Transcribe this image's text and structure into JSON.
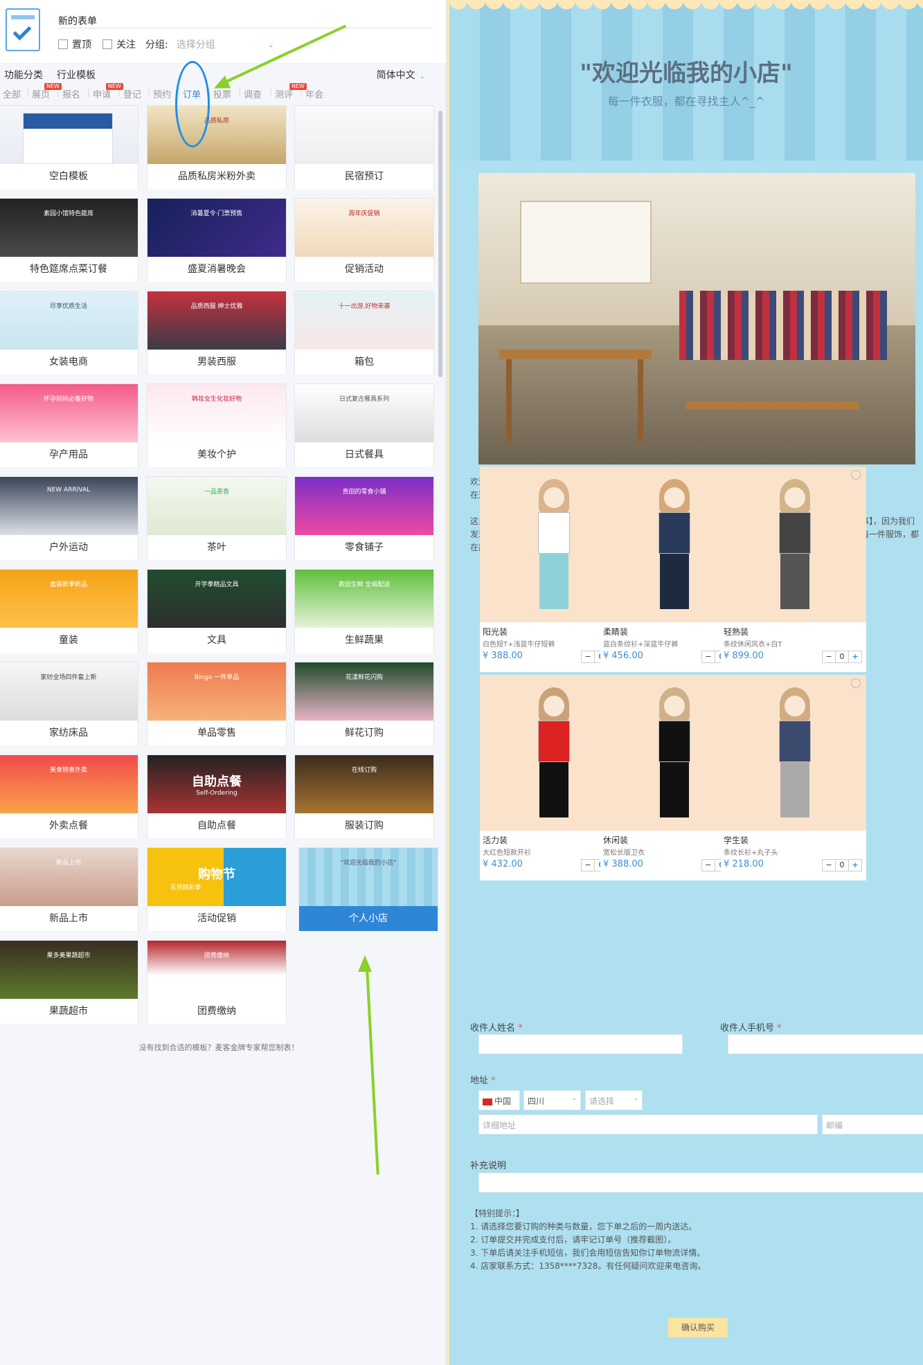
{
  "form": {
    "title": "新的表单",
    "pin_label": "置顶",
    "follow_label": "关注",
    "group_label": "分组:",
    "group_placeholder": "选择分组"
  },
  "category": {
    "func_tab": "功能分类",
    "industry_tab": "行业模板",
    "language": "简体中文"
  },
  "tabs": [
    "全部",
    "展页",
    "报名",
    "申请",
    "登记",
    "预约",
    "订单",
    "投票",
    "调查",
    "测评",
    "年会"
  ],
  "new_badge": "NEW",
  "templates": [
    {
      "name": "空白模板"
    },
    {
      "name": "品质私房米粉外卖"
    },
    {
      "name": "民宿预订"
    },
    {
      "name": "特色筵席点菜订餐"
    },
    {
      "name": "盛夏消暑晚会"
    },
    {
      "name": "促销活动"
    },
    {
      "name": "女装电商"
    },
    {
      "name": "男装西服"
    },
    {
      "name": "箱包"
    },
    {
      "name": "孕产用品"
    },
    {
      "name": "美妆个护"
    },
    {
      "name": "日式餐具"
    },
    {
      "name": "户外运动"
    },
    {
      "name": "茶叶"
    },
    {
      "name": "零食铺子"
    },
    {
      "name": "童装"
    },
    {
      "name": "文具"
    },
    {
      "name": "生鲜蔬果"
    },
    {
      "name": "家纺床品"
    },
    {
      "name": "单品零售"
    },
    {
      "name": "鲜花订购"
    },
    {
      "name": "外卖点餐"
    },
    {
      "name": "自助点餐"
    },
    {
      "name": "服装订购"
    },
    {
      "name": "新品上市"
    },
    {
      "name": "活动促销"
    },
    {
      "name": "个人小店"
    },
    {
      "name": "果蔬超市"
    },
    {
      "name": "团费缴纳"
    }
  ],
  "thumb_text": {
    "mifen": "品质私房",
    "tese": "素园小馆特色筵席",
    "shengxia": "消暑夏令·门票预售",
    "cuxiao": "周年庆促销",
    "nvzhuang": "尽享优质生活",
    "nanzhuang": "品质西服 绅士优雅",
    "xiangbao": "十一出游,好物来袭",
    "yunchan": "怀孕妈妈必备好物",
    "meizhuang": "韩妆女生化妆好物",
    "canju": "日式复古餐具系列",
    "huwai": "NEW ARRIVAL",
    "chaye": "一品茶香",
    "lingshi": "青田的零食小铺",
    "tongzhuang": "童装新季新品",
    "wenju": "开学季精品文具",
    "shengxian": "表田生鲜 全城配送",
    "jiafang": "家纺全场四件套上新",
    "danpin": "Bingo 一件单品",
    "xianhua": "花漾鲜花闪购",
    "waimai": "美食特惠外卖",
    "zizhu": "自助点餐",
    "zizhu_en": "Self-Ordering",
    "fuzhuang": "在线订购",
    "xinpin": "新品上市",
    "gouwu": "购物节",
    "gouwu_sub": "百货精彩季",
    "xiaodian": "\"欢迎光临我的小店\"",
    "guoshu": "果多美果蔬超市",
    "tuanfei": "团费缴纳"
  },
  "footer_hint": "没有找到合适的模板？麦客金牌专家帮您制表！",
  "shop": {
    "title": "\"欢迎光临我的小店\"",
    "subtitle": "每一件衣服，都在寻找主人^_^",
    "intro": [
      "欢迎来到我的小店：",
      "在这里，每一件衣服都在期待它的主人。",
      "",
      "这里是集衣服与饰品为一体的店铺，提供高级定制、服装搭配和形象设计。我的小店之所以起名为【寻人启事】，因为我们发现很多人并不了解什么样的服饰才适合自己。找到合适的衣服，美丽年轻的就如经历了时间旅行，这里的每一件服饰，都在静静地寻找它的主人..."
    ],
    "products": [
      {
        "name": "阳光装",
        "desc": "白色短T+浅蓝牛仔短裤",
        "price": "¥ 388.00",
        "qty": "0"
      },
      {
        "name": "柔睛装",
        "desc": "蓝白条纹衫+深蓝牛仔裤",
        "price": "¥ 456.00",
        "qty": "0"
      },
      {
        "name": "轻熟装",
        "desc": "条纹休闲风衣+白T",
        "price": "¥ 899.00",
        "qty": "0"
      },
      {
        "name": "活力装",
        "desc": "大红色短款开衫",
        "price": "¥ 432.00",
        "qty": "0"
      },
      {
        "name": "休闲装",
        "desc": "宽松长版卫衣",
        "price": "¥ 388.00",
        "qty": "0"
      },
      {
        "name": "学生装",
        "desc": "条纹长衫+丸子头",
        "price": "¥ 218.00",
        "qty": "0"
      }
    ],
    "minus": "−",
    "plus": "+",
    "name_label": "收件人姓名",
    "phone_label": "收件人手机号",
    "required": "*",
    "addr_label": "地址",
    "country": "中国",
    "province": "四川",
    "city_placeholder": "请选择",
    "detail_placeholder": "详细地址",
    "zip_placeholder": "邮编",
    "note_label": "补充说明",
    "tips": [
      "【特别提示：】",
      "1. 请选择您要订购的种类与数量，您下单之后的一周内送达。",
      "2. 订单提交并完成支付后，请牢记订单号（推荐截图）。",
      "3. 下单后请关注手机短信，我们会用短信告知你订单物流详情。",
      "4. 店家联系方式：1358****7328。有任何疑问欢迎来电咨询。"
    ],
    "buy_label": "确认购买"
  },
  "colors": {
    "accent": "#2f86d6",
    "annotation_circle": "#1e8fe8",
    "annotation_arrow": "#8bd02a",
    "panel_bg": "#aee0f0",
    "price": "#3a8fd8"
  }
}
